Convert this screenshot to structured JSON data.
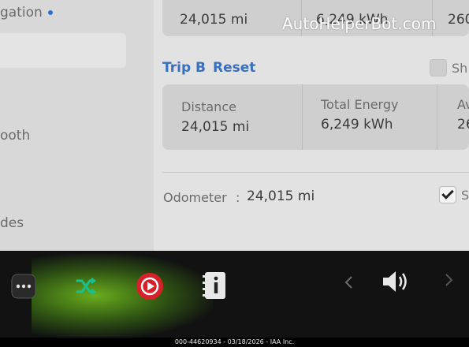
{
  "sidebar": {
    "items": [
      {
        "label": "gation"
      },
      {
        "label": "ooth"
      },
      {
        "label": "des"
      }
    ]
  },
  "trip_a": {
    "distance_value": "24,015 mi",
    "energy_value": "6,249 kWh",
    "avg_value": "260"
  },
  "trip_b": {
    "label": "Trip B",
    "reset_label": "Reset",
    "distance_label": "Distance",
    "distance_value": "24,015 mi",
    "energy_label": "Total Energy",
    "energy_value": "6,249 kWh",
    "avg_label": "Av",
    "avg_value": "26",
    "checkbox_text": "Sh"
  },
  "odometer": {
    "label": "Odometer",
    "separator": ":",
    "value": "24,015 mi",
    "checkbox_text": "S"
  },
  "watermark": "AutoHelperBot.com",
  "footer": "000-44620934 - 03/18/2026 - IAA Inc.",
  "colors": {
    "accent": "#3a6fbd",
    "sidebar_dot": "#2f6fd6",
    "media_icon": "#d8202a",
    "shuffle_icon": "#19c08f"
  }
}
